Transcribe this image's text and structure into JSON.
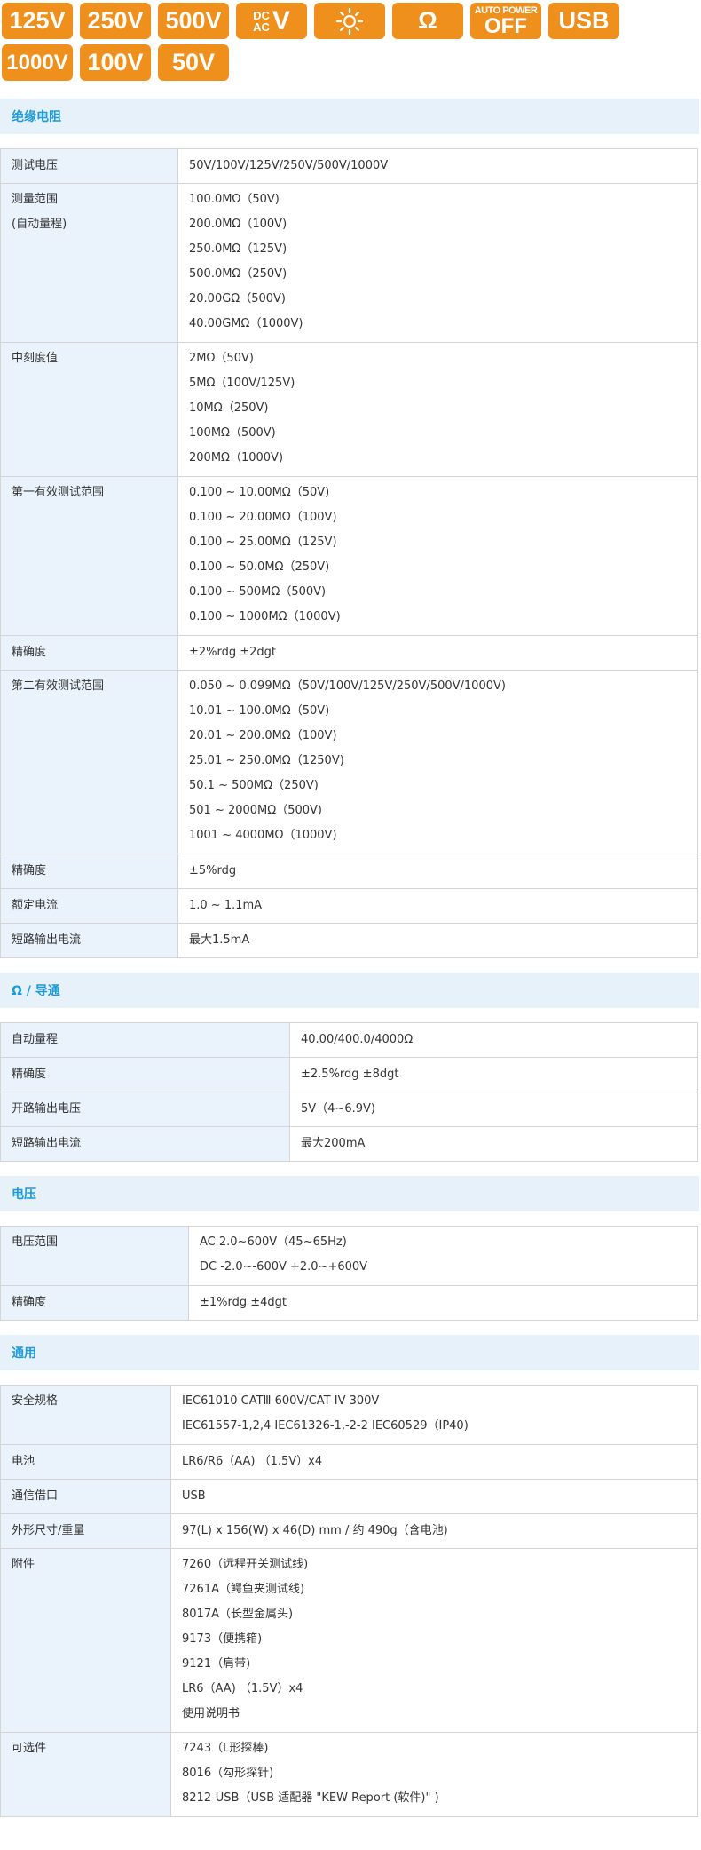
{
  "icons": {
    "row1": [
      "125V",
      "250V",
      "500V",
      "V",
      "sun",
      "Ω",
      "AUTO POWER OFF",
      "USB"
    ],
    "dcac_top": "DC",
    "dcac_bottom": "AC",
    "dcac_v": "V",
    "auto_power_small": "AUTO POWER",
    "auto_power_big": "OFF",
    "row2": [
      "1000V",
      "100V",
      "50V"
    ]
  },
  "sections": {
    "insulation": {
      "title": "绝缘电阻",
      "rows": [
        {
          "key": [
            "测试电压"
          ],
          "values": [
            "50V/100V/125V/250V/500V/1000V"
          ]
        },
        {
          "key": [
            "测量范围",
            "(自动量程)"
          ],
          "values": [
            "100.0MΩ（50V)",
            "200.0MΩ（100V)",
            "250.0MΩ（125V)",
            "500.0MΩ（250V)",
            "20.00GΩ（500V)",
            "40.00GMΩ（1000V)"
          ]
        },
        {
          "key": [
            "中刻度值"
          ],
          "values": [
            "2MΩ（50V)",
            "5MΩ（100V/125V)",
            "10MΩ（250V)",
            "100MΩ（500V)",
            "200MΩ（1000V)"
          ]
        },
        {
          "key": [
            "第一有效测试范围"
          ],
          "values": [
            "0.100 ~ 10.00MΩ（50V)",
            "0.100 ~ 20.00MΩ（100V)",
            "0.100 ~ 25.00MΩ（125V)",
            "0.100 ~ 50.0MΩ（250V)",
            "0.100 ~ 500MΩ（500V)",
            "0.100 ~ 1000MΩ（1000V)"
          ]
        },
        {
          "key": [
            "精确度"
          ],
          "values": [
            "±2%rdg ±2dgt"
          ]
        },
        {
          "key": [
            "第二有效测试范围"
          ],
          "values": [
            "0.050 ~ 0.099MΩ（50V/100V/125V/250V/500V/1000V)",
            "10.01 ~ 100.0MΩ（50V)",
            "20.01 ~ 200.0MΩ（100V)",
            "25.01 ~ 250.0MΩ（1250V)",
            "50.1 ~ 500MΩ（250V)",
            "501 ~ 2000MΩ（500V)",
            "1001 ~ 4000MΩ（1000V)"
          ]
        },
        {
          "key": [
            "精确度"
          ],
          "values": [
            "±5%rdg"
          ]
        },
        {
          "key": [
            "额定电流"
          ],
          "values": [
            "1.0 ~ 1.1mA"
          ]
        },
        {
          "key": [
            "短路输出电流"
          ],
          "values": [
            "最大1.5mA"
          ]
        }
      ]
    },
    "continuity": {
      "title": "Ω / 导通",
      "rows": [
        {
          "key": [
            "自动量程"
          ],
          "values": [
            "40.00/400.0/4000Ω"
          ]
        },
        {
          "key": [
            "精确度"
          ],
          "values": [
            "±2.5%rdg ±8dgt"
          ]
        },
        {
          "key": [
            "开路输出电压"
          ],
          "values": [
            "5V（4~6.9V)"
          ]
        },
        {
          "key": [
            "短路输出电流"
          ],
          "values": [
            "最大200mA"
          ]
        }
      ]
    },
    "voltage": {
      "title": "电压",
      "rows": [
        {
          "key": [
            "电压范围"
          ],
          "values": [
            "AC 2.0~600V（45~65Hz)",
            "DC -2.0~-600V +2.0~+600V"
          ]
        },
        {
          "key": [
            "精确度"
          ],
          "values": [
            "±1%rdg ±4dgt"
          ]
        }
      ]
    },
    "general": {
      "title": "通用",
      "rows": [
        {
          "key": [
            "安全规格"
          ],
          "values": [
            "IEC61010 CATⅢ 600V/CAT IV 300V",
            "IEC61557-1,2,4 IEC61326-1,-2-2 IEC60529（IP40)"
          ]
        },
        {
          "key": [
            "电池"
          ],
          "values": [
            "LR6/R6（AA) （1.5V）x4"
          ]
        },
        {
          "key": [
            "通信借口"
          ],
          "values": [
            "USB"
          ]
        },
        {
          "key": [
            "外形尺寸/重量"
          ],
          "values": [
            "97(L) x 156(W) x 46(D) mm / 约 490g（含电池)"
          ]
        },
        {
          "key": [
            "附件"
          ],
          "values": [
            "7260（远程开关测试线)",
            "7261A（鳄鱼夹测试线)",
            "8017A（长型金属头)",
            "9173（便携箱)",
            "9121（肩带)",
            "LR6（AA) （1.5V）x4",
            "使用说明书"
          ]
        },
        {
          "key": [
            "可选件"
          ],
          "values": [
            "7243（L形探棒)",
            "8016（勾形探针)",
            "8212-USB（USB 适配器 \"KEW Report (软件)\" )"
          ]
        }
      ]
    }
  }
}
